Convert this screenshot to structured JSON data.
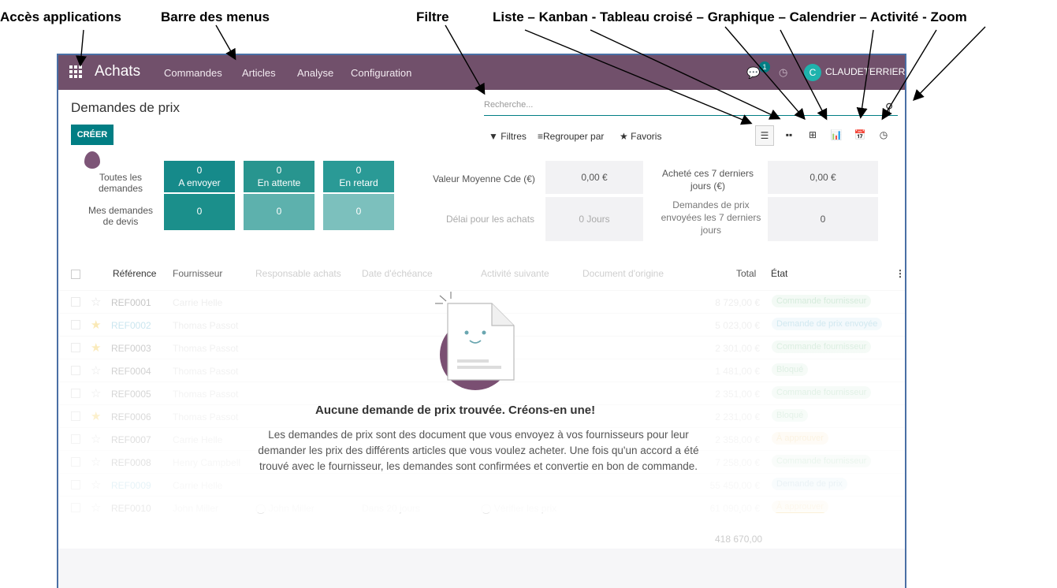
{
  "annotations": {
    "acces": "Accès applications",
    "barre": "Barre des menus",
    "filtre": "Filtre",
    "vues": "Liste – Kanban - Tableau croisé – Graphique – Calendrier – Activité - Zoom"
  },
  "topbar": {
    "app_name": "Achats",
    "menus": [
      "Commandes",
      "Articles",
      "Analyse",
      "Configuration"
    ],
    "notif_count": "1",
    "avatar_letter": "C",
    "user": "CLAUDETERRIER",
    "color": "#71506b"
  },
  "page": {
    "title": "Demandes de prix",
    "create_label": "CRÉER",
    "search_placeholder": "Recherche...",
    "filters": "Filtres",
    "group_by": "Regrouper par",
    "favorites": "Favoris"
  },
  "dashboard": {
    "row1_label": "Toutes les demandes",
    "row2_label": "Mes demandes de devis",
    "tiles_row1": [
      {
        "value": "0",
        "label": "A envoyer"
      },
      {
        "value": "0",
        "label": "En attente"
      },
      {
        "value": "0",
        "label": "En retard"
      }
    ],
    "tiles_row2": [
      "0",
      "0",
      "0"
    ],
    "stats": [
      {
        "label": "Valeur Moyenne Cde (€)",
        "value": "0,00 €"
      },
      {
        "label": "Acheté ces 7 derniers jours (€)",
        "value": "0,00 €"
      },
      {
        "label": "Délai pour les achats",
        "value": "0  Jours"
      },
      {
        "label": "Demandes de prix envoyées les 7 derniers jours",
        "value": "0"
      }
    ]
  },
  "table": {
    "headers": [
      "Référence",
      "Fournisseur",
      "Responsable achats",
      "Date d'échéance",
      "Activité suivante",
      "Document d'origine",
      "Total",
      "État"
    ],
    "rows": [
      {
        "ref": "REF0001",
        "supplier": "Carrie Helle",
        "total": "8 729,00 €",
        "state": "Commande fournisseur",
        "star": false
      },
      {
        "ref": "REF0002",
        "supplier": "Thomas Passot",
        "total": "5 023,00 €",
        "state": "Demande de prix envoyée",
        "star": true
      },
      {
        "ref": "REF0003",
        "supplier": "Thomas Passot",
        "total": "2 301,00 €",
        "state": "Commande fournisseur",
        "star": true
      },
      {
        "ref": "REF0004",
        "supplier": "Thomas Passot",
        "total": "1 481,00 €",
        "state": "Bloqué",
        "star": false
      },
      {
        "ref": "REF0005",
        "supplier": "Thomas Passot",
        "total": "2 351,00 €",
        "state": "Commande fournisseur",
        "star": false
      },
      {
        "ref": "REF0006",
        "supplier": "Thomas Passot",
        "total": "2 231,00 €",
        "state": "Bloqué",
        "star": true
      },
      {
        "ref": "REF0007",
        "supplier": "Carrie Helle",
        "total": "2 358,00 €",
        "state": "À approuver",
        "star": false
      },
      {
        "ref": "REF0008",
        "supplier": "Henry Campbell",
        "total": "7 258,00 €",
        "state": "Commande fournisseur",
        "star": false
      },
      {
        "ref": "REF0009",
        "supplier": "Carrie Helle",
        "total": "55 450,00 €",
        "state": "Demande de prix",
        "star": false
      },
      {
        "ref": "REF0010",
        "supplier": "John Miller",
        "total": "61 090,00 €",
        "state": "À approuver",
        "star": false
      }
    ],
    "row10_extra": {
      "responsible": "John Miller",
      "due": "Dans 20 jours",
      "activity": "Vérifier les prix"
    },
    "grand_total": "418 670,00"
  },
  "empty": {
    "title": "Aucune demande de prix trouvée. Créons-en une!",
    "text": "Les demandes de prix sont des document que vous envoyez à vos fournisseurs pour leur demander les prix des différents articles que vous voulez acheter. Une fois qu'un accord a été trouvé avec le fournisseur, les demandes sont confirmées et convertie en bon de commande."
  }
}
